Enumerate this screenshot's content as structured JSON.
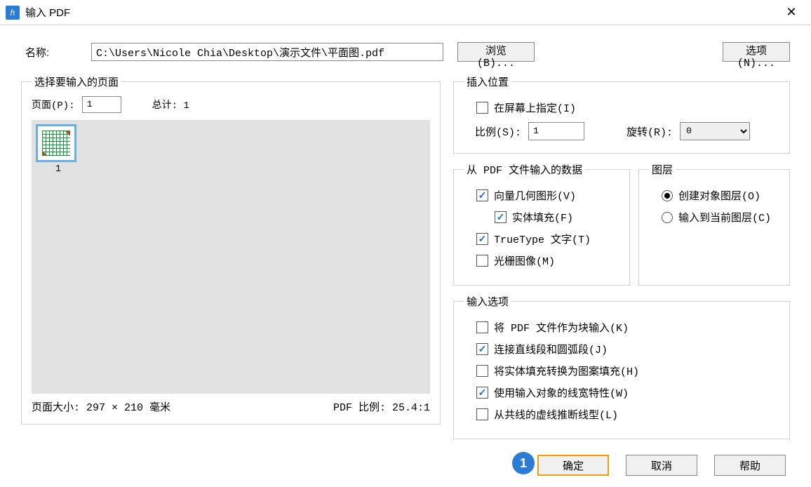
{
  "titlebar": {
    "title": "输入 PDF"
  },
  "name_row": {
    "label": "名称:",
    "path": "C:\\Users\\Nicole Chia\\Desktop\\演示文件\\平面图.pdf",
    "browse": "浏览(B)...",
    "options": "选项(N)..."
  },
  "page_select": {
    "legend": "选择要输入的页面",
    "page_label": "页面(P):",
    "page_value": "1",
    "total_label": "总计:  1",
    "thumb_num": "1",
    "page_size": "页面大小:  297 × 210 毫米",
    "pdf_ratio": "PDF 比例:  25.4:1"
  },
  "insert": {
    "legend": "插入位置",
    "on_screen": "在屏幕上指定(I)",
    "scale_label": "比例(S):",
    "scale_value": "1",
    "rotate_label": "旋转(R):",
    "rotate_value": "0"
  },
  "pdf_data": {
    "legend": "从 PDF 文件输入的数据",
    "vector": "向量几何图形(V)",
    "solid_fill": "实体填充(F)",
    "truetype": "TrueType 文字(T)",
    "raster": "光栅图像(M)"
  },
  "layer": {
    "legend": "图层",
    "create": "创建对象图层(O)",
    "current": "输入到当前图层(C)"
  },
  "import_opts": {
    "legend": "输入选项",
    "as_block": "将 PDF 文件作为块输入(K)",
    "join": "连接直线段和圆弧段(J)",
    "hatch": "将实体填充转换为图案填充(H)",
    "lineweight": "使用输入对象的线宽特性(W)",
    "infer_lt": "从共线的虚线推断线型(L)"
  },
  "footer": {
    "ok": "确定",
    "cancel": "取消",
    "help": "帮助",
    "badge": "1"
  }
}
